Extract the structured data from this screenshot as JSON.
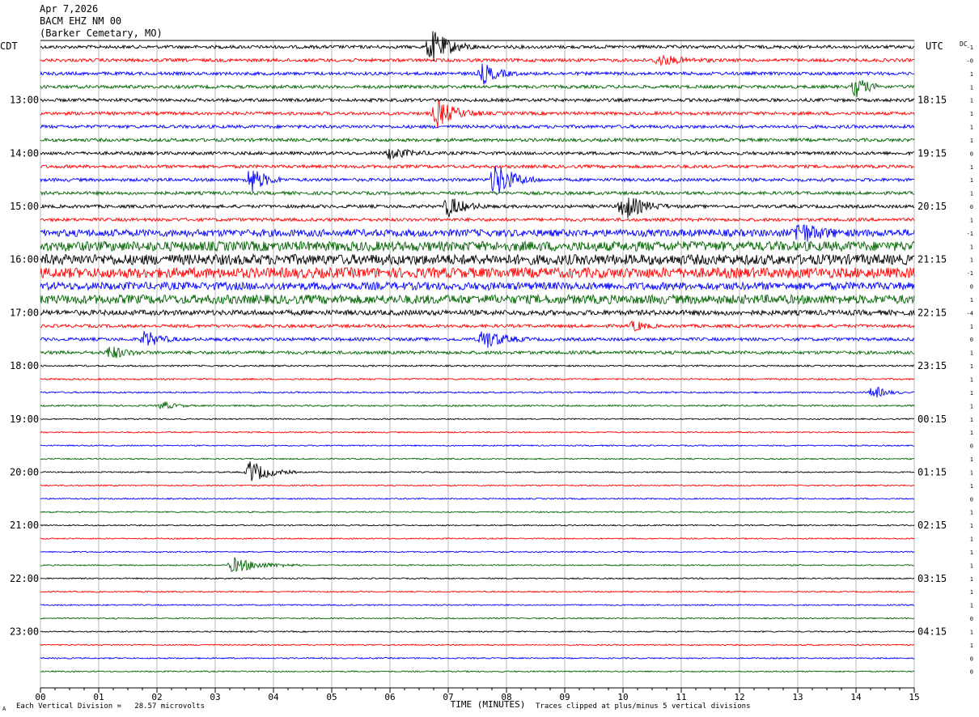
{
  "header": {
    "date": "Apr 7,2026",
    "channel": "BACM EHZ NM 00",
    "location": "(Barker Cemetary, MO)"
  },
  "left_label": "CDT",
  "right_label": "UTC",
  "dc_label": "DC",
  "footer": {
    "scale_note": "Each Vertical Division =   28.57 microvolts",
    "clip_note": "Traces clipped at plus/minus 5 vertical divisions",
    "corner_mark": "A"
  },
  "chart_data": {
    "type": "line",
    "title": "",
    "xlabel": "TIME (MINUTES)",
    "ylabel": "",
    "xlim": [
      0,
      15
    ],
    "x_ticks": [
      "00",
      "01",
      "02",
      "03",
      "04",
      "05",
      "06",
      "07",
      "08",
      "09",
      "10",
      "11",
      "12",
      "13",
      "14",
      "15"
    ],
    "trace_count": 48,
    "trace_colors": [
      "#000000",
      "#ff0000",
      "#0000ff",
      "#006400"
    ],
    "left_time_labels": [
      {
        "trace": 4,
        "label": "13:00"
      },
      {
        "trace": 8,
        "label": "14:00"
      },
      {
        "trace": 12,
        "label": "15:00"
      },
      {
        "trace": 16,
        "label": "16:00"
      },
      {
        "trace": 20,
        "label": "17:00"
      },
      {
        "trace": 24,
        "label": "18:00"
      },
      {
        "trace": 28,
        "label": "19:00"
      },
      {
        "trace": 32,
        "label": "20:00"
      },
      {
        "trace": 36,
        "label": "21:00"
      },
      {
        "trace": 40,
        "label": "22:00"
      },
      {
        "trace": 44,
        "label": "23:00"
      }
    ],
    "right_time_labels": [
      {
        "trace": 4,
        "label": "18:15"
      },
      {
        "trace": 8,
        "label": "19:15"
      },
      {
        "trace": 12,
        "label": "20:15"
      },
      {
        "trace": 16,
        "label": "21:15"
      },
      {
        "trace": 20,
        "label": "22:15"
      },
      {
        "trace": 24,
        "label": "23:15"
      },
      {
        "trace": 28,
        "label": "00:15"
      },
      {
        "trace": 32,
        "label": "01:15"
      },
      {
        "trace": 36,
        "label": "02:15"
      },
      {
        "trace": 40,
        "label": "03:15"
      },
      {
        "trace": 44,
        "label": "04:15"
      }
    ],
    "dc_offsets": [
      "-1",
      "-0",
      "1",
      "1",
      "1",
      "1",
      "1",
      "1",
      "0",
      "1",
      "1",
      "1",
      "0",
      "1",
      "-1",
      "1",
      "1",
      "-1",
      "0",
      "1",
      "-4",
      "1",
      "0",
      "1",
      "1",
      "1",
      "1",
      "1",
      "1",
      "1",
      "0",
      "1",
      "1",
      "1",
      "0",
      "1",
      "1",
      "1",
      "1",
      "1",
      "1",
      "1",
      "1",
      "0",
      "1",
      "1",
      "0",
      "0"
    ],
    "noise_level": [
      1,
      1,
      1,
      1,
      1,
      1,
      1,
      1,
      1,
      1,
      1,
      1,
      1,
      1,
      2.2,
      3,
      3.2,
      3.2,
      2.4,
      2.8,
      1.6,
      1,
      1,
      1,
      0.5,
      0.5,
      0.5,
      0.5,
      0.4,
      0.4,
      0.4,
      0.4,
      0.4,
      0.4,
      0.4,
      0.4,
      0.4,
      0.4,
      0.4,
      0.4,
      0.4,
      0.4,
      0.4,
      0.4,
      0.4,
      0.4,
      0.4,
      0.4
    ],
    "events": [
      {
        "trace": 0,
        "minute": 6.7,
        "amplitude": 5,
        "duration_min": 0.8
      },
      {
        "trace": 1,
        "minute": 10.6,
        "amplitude": 1.5,
        "duration_min": 1.0
      },
      {
        "trace": 2,
        "minute": 7.6,
        "amplitude": 3,
        "duration_min": 0.6
      },
      {
        "trace": 3,
        "minute": 14.0,
        "amplitude": 3,
        "duration_min": 0.5
      },
      {
        "trace": 5,
        "minute": 6.8,
        "amplitude": 4,
        "duration_min": 0.8
      },
      {
        "trace": 8,
        "minute": 6.0,
        "amplitude": 1.6,
        "duration_min": 0.8
      },
      {
        "trace": 10,
        "minute": 3.6,
        "amplitude": 4,
        "duration_min": 0.6
      },
      {
        "trace": 10,
        "minute": 7.8,
        "amplitude": 5,
        "duration_min": 0.8
      },
      {
        "trace": 12,
        "minute": 7.0,
        "amplitude": 3,
        "duration_min": 0.7
      },
      {
        "trace": 12,
        "minute": 10.0,
        "amplitude": 4,
        "duration_min": 0.8
      },
      {
        "trace": 14,
        "minute": 13.0,
        "amplitude": 3,
        "duration_min": 0.8
      },
      {
        "trace": 21,
        "minute": 10.2,
        "amplitude": 1.6,
        "duration_min": 0.4
      },
      {
        "trace": 22,
        "minute": 1.8,
        "amplitude": 2.5,
        "duration_min": 0.6
      },
      {
        "trace": 22,
        "minute": 7.6,
        "amplitude": 3,
        "duration_min": 0.8
      },
      {
        "trace": 23,
        "minute": 1.2,
        "amplitude": 2,
        "duration_min": 0.6
      },
      {
        "trace": 26,
        "minute": 14.3,
        "amplitude": 2,
        "duration_min": 0.5
      },
      {
        "trace": 27,
        "minute": 2.1,
        "amplitude": 1.2,
        "duration_min": 0.5
      },
      {
        "trace": 32,
        "minute": 3.6,
        "amplitude": 3.5,
        "duration_min": 0.8
      },
      {
        "trace": 39,
        "minute": 3.3,
        "amplitude": 2.2,
        "duration_min": 1.2
      }
    ]
  }
}
